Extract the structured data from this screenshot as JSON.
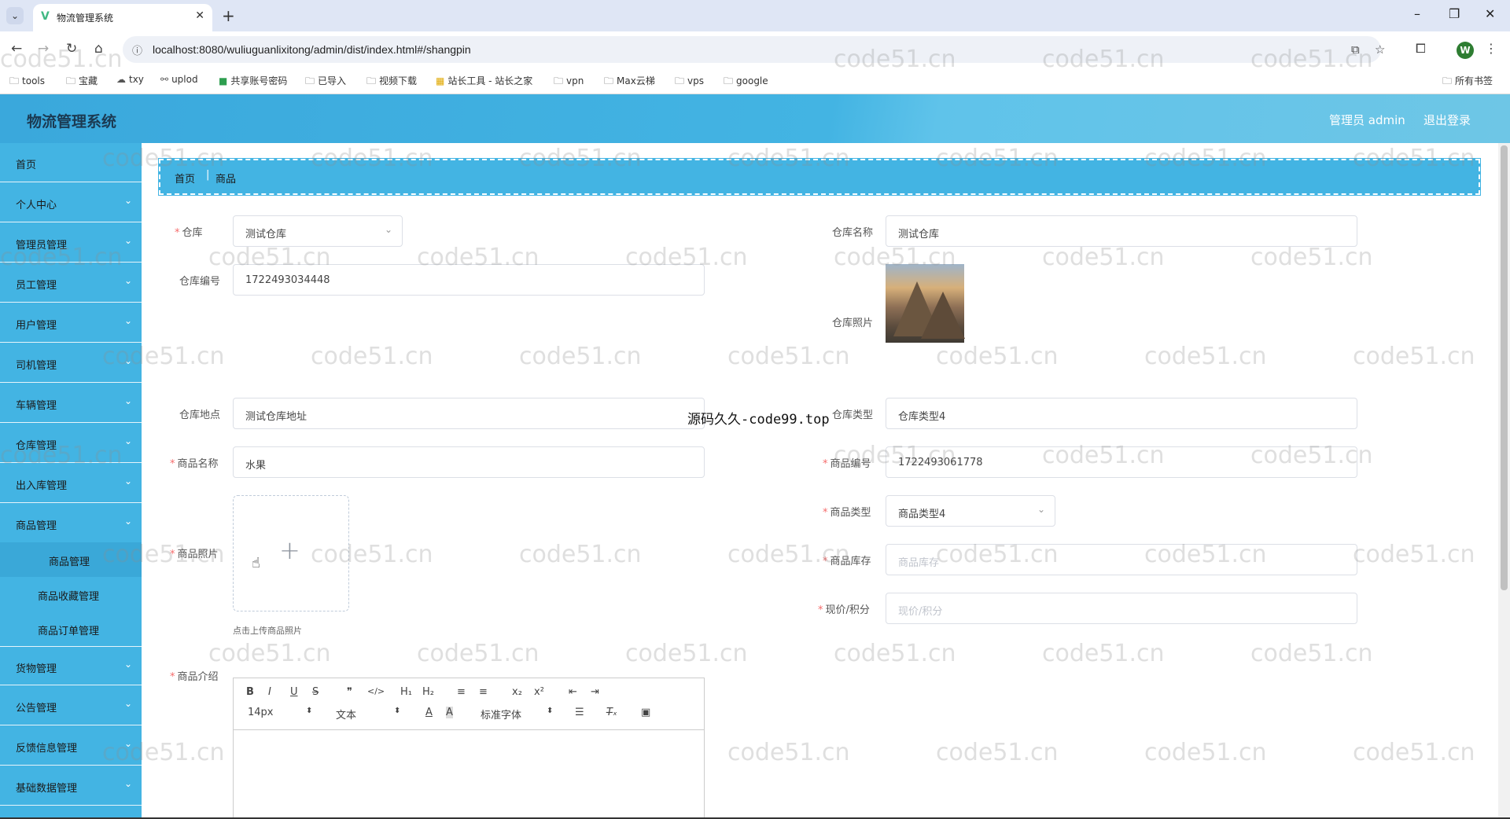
{
  "browser": {
    "tab_title": "物流管理系统",
    "url": "localhost:8080/wuliuguanlixitong/admin/dist/index.html#/shangpin",
    "profile_initial": "W",
    "bookmarks": [
      "tools",
      "宝藏",
      "txy",
      "uplod",
      "共享账号密码",
      "已导入",
      "视频下载",
      "站长工具 - 站长之家",
      "vpn",
      "Max云梯",
      "vps",
      "google"
    ],
    "all_bookmarks": "所有书签"
  },
  "header": {
    "title": "物流管理系统",
    "user": "管理员 admin",
    "logout": "退出登录"
  },
  "sidebar": {
    "items": [
      {
        "label": "首页"
      },
      {
        "label": "个人中心"
      },
      {
        "label": "管理员管理"
      },
      {
        "label": "员工管理"
      },
      {
        "label": "用户管理"
      },
      {
        "label": "司机管理"
      },
      {
        "label": "车辆管理"
      },
      {
        "label": "仓库管理"
      },
      {
        "label": "出入库管理"
      },
      {
        "label": "商品管理"
      },
      {
        "label": "货物管理"
      },
      {
        "label": "公告管理"
      },
      {
        "label": "反馈信息管理"
      },
      {
        "label": "基础数据管理"
      }
    ],
    "sub_items": [
      {
        "label": "商品管理"
      },
      {
        "label": "商品收藏管理"
      },
      {
        "label": "商品订单管理"
      }
    ]
  },
  "breadcrumb": {
    "home": "首页",
    "separator": "|",
    "current": "商品"
  },
  "form": {
    "cangku": {
      "label": "仓库",
      "value": "测试仓库"
    },
    "cangku_name": {
      "label": "仓库名称",
      "value": "测试仓库"
    },
    "cangku_uuid": {
      "label": "仓库编号",
      "value": "1722493034448"
    },
    "cangku_photo": {
      "label": "仓库照片"
    },
    "cangku_address": {
      "label": "仓库地点",
      "value": "测试仓库地址"
    },
    "cangku_type": {
      "label": "仓库类型",
      "value": "仓库类型4"
    },
    "shangpin_name": {
      "label": "商品名称",
      "value": "水果"
    },
    "shangpin_uuid": {
      "label": "商品编号",
      "value": "1722493061778"
    },
    "shangpin_type": {
      "label": "商品类型",
      "value": "商品类型4"
    },
    "shangpin_photo": {
      "label": "商品照片",
      "tip": "点击上传商品照片"
    },
    "shangpin_stock": {
      "label": "商品库存",
      "placeholder": "商品库存"
    },
    "shangpin_price": {
      "label": "现价/积分",
      "placeholder": "现价/积分"
    },
    "shangpin_content": {
      "label": "商品介绍"
    }
  },
  "editor": {
    "row1": [
      "B",
      "I",
      "U",
      "S",
      "❞",
      "</>",
      "H₁",
      "H₂",
      "≡",
      "≡",
      "x₂",
      "x²",
      "⇤",
      "⇥"
    ],
    "font_size": "14px",
    "text_style": "文本",
    "font_family": "标准字体"
  },
  "watermarks": {
    "site": "code51.cn",
    "site2": "源码久久-code99.top"
  }
}
